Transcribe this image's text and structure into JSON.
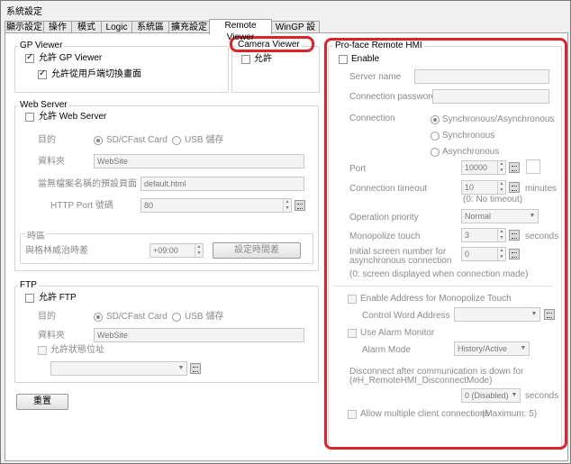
{
  "window": {
    "title": "系統設定"
  },
  "tabs": [
    "顯示設定",
    "操作",
    "模式",
    "Logic",
    "系統區",
    "擴充設定",
    "Remote Viewer",
    "WinGP 設定"
  ],
  "gp_viewer": {
    "legend": "GP Viewer",
    "allow_label": "允許 GP Viewer",
    "allow_switch_label": "允許從用戶端切換畫面"
  },
  "camera_viewer": {
    "legend": "Camera Viewer",
    "allow_label": "允許"
  },
  "web_server": {
    "legend": "Web Server",
    "allow_label": "允許 Web Server",
    "target_label": "目的",
    "target_sd": "SD/CFast Card",
    "target_usb": "USB 儲存",
    "folder_label": "資料夾",
    "folder_value": "WebSite",
    "default_page_label": "當無檔案名稱的預設頁面",
    "default_page_value": "default.html",
    "http_port_label": "HTTP Port 號碼",
    "http_port_value": "80",
    "timezone_legend": "時區",
    "gmt_label": "與格林威治時差",
    "gmt_value": "+09:00",
    "set_tz_button": "設定時間差"
  },
  "ftp": {
    "legend": "FTP",
    "allow_label": "允許 FTP",
    "target_label": "目的",
    "target_sd": "SD/CFast Card",
    "target_usb": "USB 儲存",
    "folder_label": "資料夾",
    "folder_value": "WebSite",
    "allow_status_label": "允許狀態位址"
  },
  "reset_button": "重置",
  "remote_hmi": {
    "legend": "Pro-face Remote HMI",
    "enable_label": "Enable",
    "server_name_label": "Server name",
    "conn_password_label": "Connection password",
    "connection_label": "Connection",
    "opt_sync_async": "Synchronous/Asynchronous",
    "opt_sync": "Synchronous",
    "opt_async": "Asynchronous",
    "port_label": "Port",
    "port_value": "10000",
    "conn_timeout_label": "Connection timeout",
    "conn_timeout_value": "10",
    "minutes_label": "minutes",
    "no_timeout_note": "(0: No timeout)",
    "op_priority_label": "Operation priority",
    "op_priority_value": "Normal",
    "monopolize_label": "Monopolize touch",
    "monopolize_value": "3",
    "seconds_label": "seconds",
    "initial_screen_label_1": "Initial screen number for",
    "initial_screen_label_2": "asynchronous connection",
    "initial_screen_value": "0",
    "initial_screen_note": "(0: screen displayed when connection made)",
    "enable_addr_label": "Enable Address for Monopolize Touch",
    "control_word_label": "Control Word Address",
    "use_alarm_label": "Use Alarm Monitor",
    "alarm_mode_label": "Alarm Mode",
    "alarm_mode_value": "History/Active",
    "disconnect_label_1": "Disconnect after communication is down for",
    "disconnect_label_2": "(#H_RemoteHMI_DisconnectMode)",
    "disconnect_value": "0 (Disabled)",
    "disconnect_seconds": "seconds",
    "allow_multi_label": "Allow multiple client connections",
    "allow_multi_note": "(Maximum: 5)"
  },
  "colors": {
    "highlight": "#d9262c"
  }
}
